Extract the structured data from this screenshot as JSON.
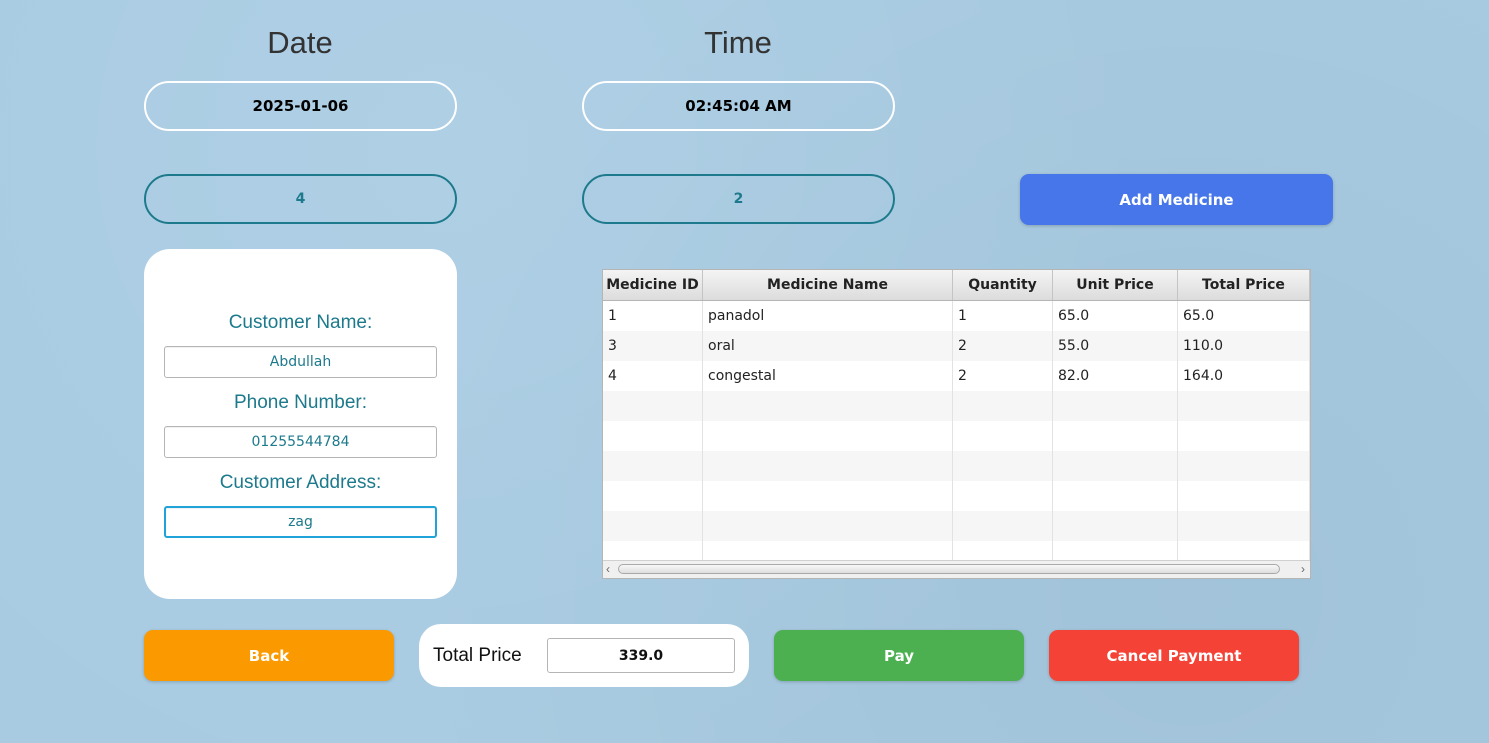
{
  "header": {
    "date_label": "Date",
    "time_label": "Time"
  },
  "date_value": "2025-01-06",
  "time_value": "02:45:04 AM",
  "counter_left": "4",
  "counter_right": "2",
  "add_medicine_label": "Add Medicine",
  "customer": {
    "name_label": "Customer Name:",
    "name_value": "Abdullah",
    "phone_label": "Phone Number:",
    "phone_value": "01255544784",
    "address_label": "Customer Address:",
    "address_value": "zag"
  },
  "table": {
    "columns": [
      "Medicine ID",
      "Medicine Name",
      "Quantity",
      "Unit Price",
      "Total Price"
    ],
    "rows": [
      [
        "1",
        "panadol",
        "1",
        "65.0",
        "65.0"
      ],
      [
        "3",
        "oral",
        "2",
        "55.0",
        "110.0"
      ],
      [
        "4",
        "congestal",
        "2",
        "82.0",
        "164.0"
      ]
    ]
  },
  "footer": {
    "back_label": "Back",
    "total_label": "Total Price",
    "total_value": "339.0",
    "pay_label": "Pay",
    "cancel_label": "Cancel Payment"
  },
  "colors": {
    "background": "#a8cbe2",
    "accent_teal": "#1d7a8c",
    "add_button": "#4676ea",
    "back_button": "#fb9a00",
    "pay_button": "#4caf50",
    "cancel_button": "#f44336"
  }
}
